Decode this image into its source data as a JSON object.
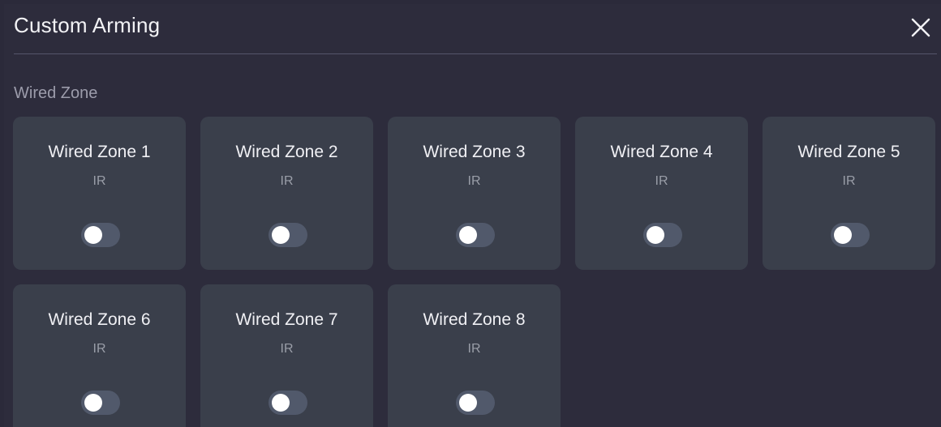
{
  "dialog": {
    "title": "Custom Arming",
    "section_label": "Wired Zone"
  },
  "icons": {
    "close": "close-icon"
  },
  "colors": {
    "background": "#2d2c3c",
    "card": "#3a3f4b",
    "toggle_off_track": "#51596b",
    "toggle_knob": "#ffffff"
  },
  "zones": [
    {
      "name": "Wired Zone 1",
      "type": "IR",
      "armed": false
    },
    {
      "name": "Wired Zone 2",
      "type": "IR",
      "armed": false
    },
    {
      "name": "Wired Zone 3",
      "type": "IR",
      "armed": false
    },
    {
      "name": "Wired Zone 4",
      "type": "IR",
      "armed": false
    },
    {
      "name": "Wired Zone 5",
      "type": "IR",
      "armed": false
    },
    {
      "name": "Wired Zone 6",
      "type": "IR",
      "armed": false
    },
    {
      "name": "Wired Zone 7",
      "type": "IR",
      "armed": false
    },
    {
      "name": "Wired Zone 8",
      "type": "IR",
      "armed": false
    }
  ]
}
